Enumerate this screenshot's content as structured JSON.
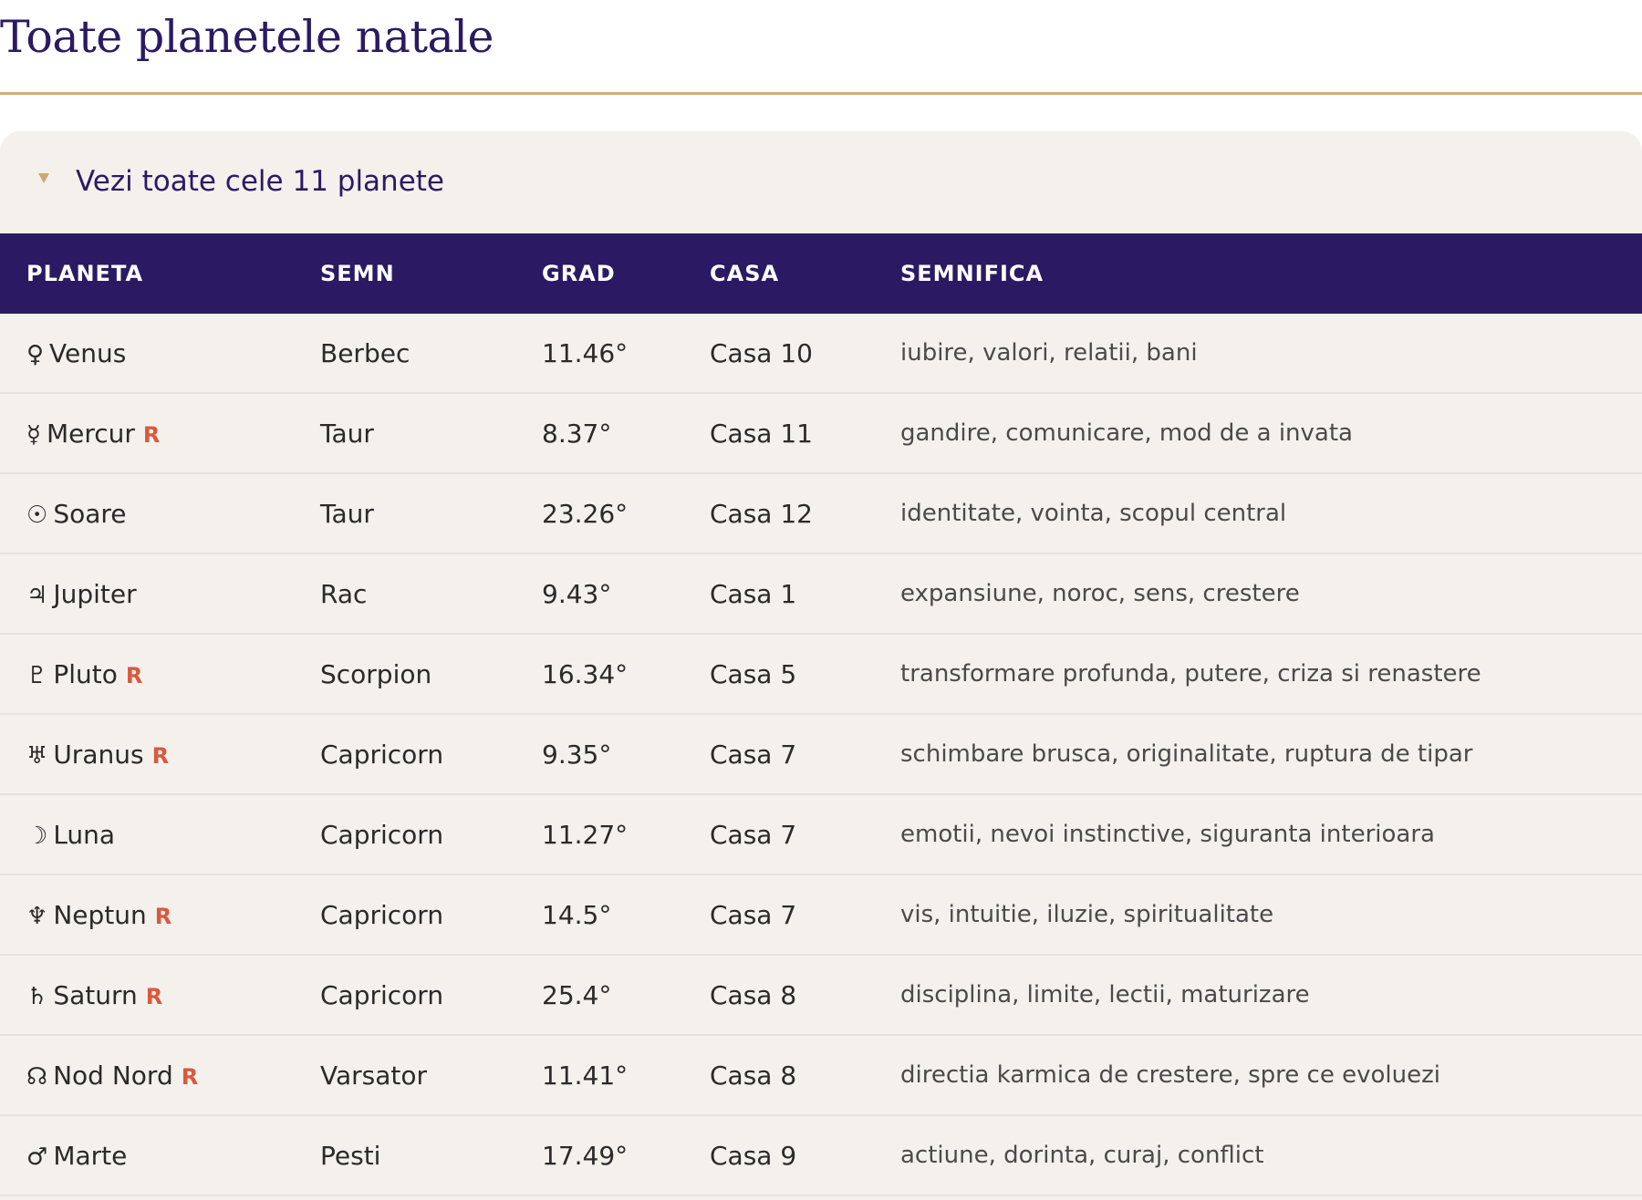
{
  "page": {
    "title": "Toate planetele natale"
  },
  "details": {
    "summary_label": "Vezi toate cele 11 planete",
    "expanded": true
  },
  "table": {
    "headers": {
      "planet": "PLANETA",
      "sign": "SEMN",
      "degree": "GRAD",
      "house": "CASA",
      "meaning": "SEMNIFICA"
    },
    "retrograde_marker": "R",
    "rows": [
      {
        "glyph": "♀",
        "planet": "Venus",
        "retrograde": false,
        "sign": "Berbec",
        "degree": "11.46°",
        "house": "Casa 10",
        "meaning": "iubire, valori, relatii, bani"
      },
      {
        "glyph": "☿",
        "planet": "Mercur",
        "retrograde": true,
        "sign": "Taur",
        "degree": "8.37°",
        "house": "Casa 11",
        "meaning": "gandire, comunicare, mod de a invata"
      },
      {
        "glyph": "☉",
        "planet": "Soare",
        "retrograde": false,
        "sign": "Taur",
        "degree": "23.26°",
        "house": "Casa 12",
        "meaning": "identitate, vointa, scopul central"
      },
      {
        "glyph": "♃",
        "planet": "Jupiter",
        "retrograde": false,
        "sign": "Rac",
        "degree": "9.43°",
        "house": "Casa 1",
        "meaning": "expansiune, noroc, sens, crestere"
      },
      {
        "glyph": "♇",
        "planet": "Pluto",
        "retrograde": true,
        "sign": "Scorpion",
        "degree": "16.34°",
        "house": "Casa 5",
        "meaning": "transformare profunda, putere, criza si renastere"
      },
      {
        "glyph": "♅",
        "planet": "Uranus",
        "retrograde": true,
        "sign": "Capricorn",
        "degree": "9.35°",
        "house": "Casa 7",
        "meaning": "schimbare brusca, originalitate, ruptura de tipar"
      },
      {
        "glyph": "☽",
        "planet": "Luna",
        "retrograde": false,
        "sign": "Capricorn",
        "degree": "11.27°",
        "house": "Casa 7",
        "meaning": "emotii, nevoi instinctive, siguranta interioara"
      },
      {
        "glyph": "♆",
        "planet": "Neptun",
        "retrograde": true,
        "sign": "Capricorn",
        "degree": "14.5°",
        "house": "Casa 7",
        "meaning": "vis, intuitie, iluzie, spiritualitate"
      },
      {
        "glyph": "♄",
        "planet": "Saturn",
        "retrograde": true,
        "sign": "Capricorn",
        "degree": "25.4°",
        "house": "Casa 8",
        "meaning": "disciplina, limite, lectii, maturizare"
      },
      {
        "glyph": "☊",
        "planet": "Nod Nord",
        "retrograde": true,
        "sign": "Varsator",
        "degree": "11.41°",
        "house": "Casa 8",
        "meaning": "directia karmica de crestere, spre ce evoluezi"
      },
      {
        "glyph": "♂",
        "planet": "Marte",
        "retrograde": false,
        "sign": "Pesti",
        "degree": "17.49°",
        "house": "Casa 9",
        "meaning": "actiune, dorinta, curaj, conflict"
      }
    ]
  },
  "colors": {
    "title": "#2b1a63",
    "rule": "#d3ac78",
    "panel_bg": "#f4f1ec",
    "header_bg": "#2b1a63",
    "retrograde": "#d8593f",
    "caret": "#d0a56f"
  },
  "icons": {
    "caret": "caret-down-icon"
  }
}
